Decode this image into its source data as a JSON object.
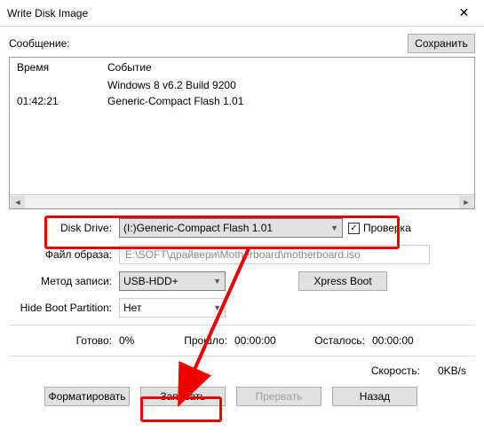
{
  "window": {
    "title": "Write Disk Image"
  },
  "message": {
    "label": "Сообщение:",
    "save": "Сохранить"
  },
  "log": {
    "headers": {
      "time": "Время",
      "event": "Событие"
    },
    "rows": [
      {
        "time": "",
        "event": "Windows 8 v6.2 Build 9200"
      },
      {
        "time": "01:42:21",
        "event": "Generic-Compact Flash   1.01"
      }
    ]
  },
  "fields": {
    "drive": {
      "label": "Disk Drive:",
      "value": "(I:)Generic-Compact Flash   1.01"
    },
    "check": {
      "label": "Проверка"
    },
    "image": {
      "label": "Файл образа:",
      "value": "E:\\SOFT\\драйвери\\Motherboard\\motherboard.iso"
    },
    "method": {
      "label": "Метод записи:",
      "value": "USB-HDD+"
    },
    "xpress": "Xpress Boot",
    "hide": {
      "label": "Hide Boot Partition:",
      "value": "Нет"
    }
  },
  "status": {
    "ready": {
      "label": "Готово:",
      "value": "0%"
    },
    "elapsed": {
      "label": "Прошло:",
      "value": "00:00:00"
    },
    "remain": {
      "label": "Осталось:",
      "value": "00:00:00"
    },
    "speed": {
      "label": "Скорость:",
      "value": "0KB/s"
    }
  },
  "buttons": {
    "format": "Форматировать",
    "write": "Записать",
    "abort": "Прервать",
    "back": "Назад"
  }
}
